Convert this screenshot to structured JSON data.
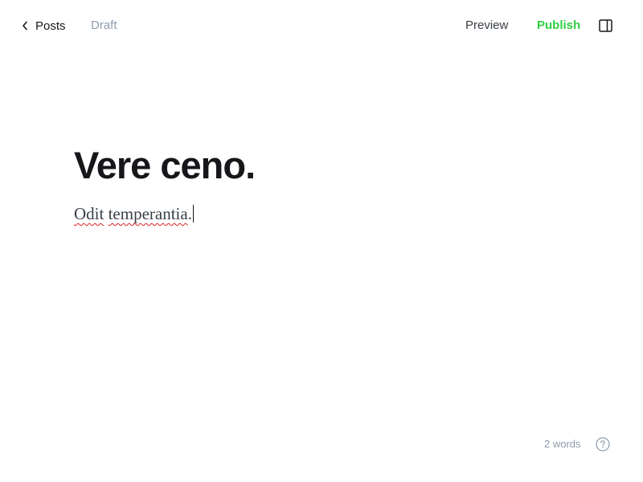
{
  "header": {
    "back_label": "Posts",
    "status": "Draft",
    "preview_label": "Preview",
    "publish_label": "Publish",
    "back_icon": "chevron-left-icon",
    "sidebar_icon": "sidebar-toggle-icon"
  },
  "editor": {
    "title": "Vere ceno.",
    "body_word1": "Odit",
    "body_word2": "temperantia",
    "body_punct": "."
  },
  "footer": {
    "word_count": "2 words",
    "help_icon": "question-circle-icon"
  },
  "colors": {
    "publish": "#30cf43",
    "muted": "#8e9cac",
    "text": "#15171a",
    "spellcheck": "#e02020"
  }
}
